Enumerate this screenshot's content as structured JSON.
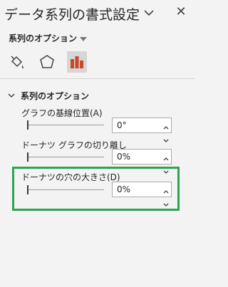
{
  "pane": {
    "title": "データ系列の書式設定",
    "close_glyph": "✕"
  },
  "options_dropdown": {
    "label": "系列のオプション"
  },
  "icon_tabs": [
    {
      "name": "fill-line-icon"
    },
    {
      "name": "effects-icon"
    },
    {
      "name": "series-options-icon",
      "selected": true
    }
  ],
  "section": {
    "header": "系列のオプション",
    "fields": [
      {
        "label": "グラフの基線位置(A)",
        "value": "0°"
      },
      {
        "label": "ドーナツ グラフの切り離し",
        "value": "0%"
      },
      {
        "label": "ドーナツの穴の大きさ(D)",
        "value": "0%"
      }
    ]
  },
  "colors": {
    "background": "#f3f3f3",
    "selected_tab": "#d6d6d6",
    "bar_icon": "#c9472a",
    "highlight": "#2ea44f"
  }
}
